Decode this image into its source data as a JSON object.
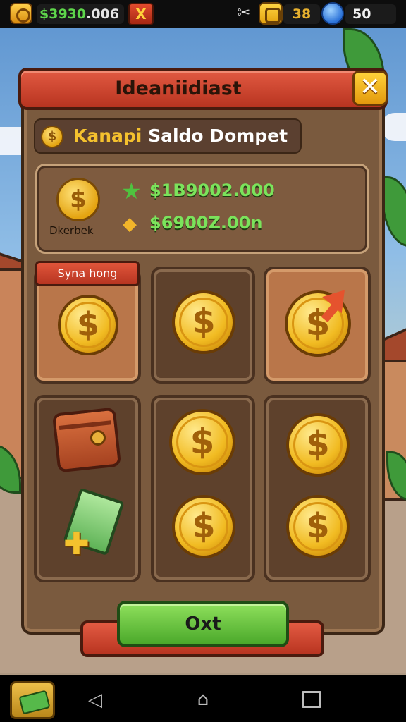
{
  "status_bar": {
    "balance_prefix": "$3930",
    "balance_suffix": ".006",
    "close_glyph": "X",
    "tools_icon": "tools-icon",
    "level": "38",
    "gems": "50"
  },
  "dialog": {
    "title": "Ideaniidiast",
    "close_glyph": "✕",
    "wallet_header": {
      "coin_glyph": "$",
      "title_highlight": "Kanapi",
      "title_rest": " Saldo Dompet"
    },
    "balance": {
      "coin_glyph": "$",
      "label": "Dkerbek",
      "value_primary": "$1B9002.000",
      "value_secondary": "$6900Z.00n",
      "star_glyph": "★",
      "gem_glyph": "◆"
    },
    "ribbon_label": "Syna hong",
    "coin_glyph": "$",
    "ok_label": "Oxt"
  },
  "nav": {
    "back_glyph": "◁",
    "home_glyph": "⌂"
  },
  "colors": {
    "panel_brown": "#7a5a3e",
    "accent_red": "#b83420",
    "coin_gold": "#f1bb22",
    "ok_green": "#4aa82a",
    "value_green": "#7be35b"
  }
}
